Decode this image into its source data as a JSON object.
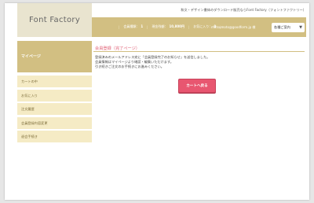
{
  "brand": {
    "logo": "Font Factory"
  },
  "header": {
    "tagline": "和文・デザイン書体のダウンロード販売ならFont Factory（フォントファクトリー）",
    "stats": [
      {
        "label": "会員種類：",
        "value": "1"
      },
      {
        "label": "現金残額：",
        "value": "10,800円"
      },
      {
        "label": "お気に入り：",
        "value": "0"
      }
    ],
    "email": "matsumoto@goodform.jp 様",
    "menu_button": "各種ご案内"
  },
  "sidebar": {
    "heading": "マイページ",
    "items": [
      {
        "label": "カートの中"
      },
      {
        "label": "お気に入り"
      },
      {
        "label": "注文履歴"
      },
      {
        "label": "会員登録内容変更"
      },
      {
        "label": "退会手続き"
      }
    ]
  },
  "main": {
    "title": "会員登録（完了ページ）",
    "lines": [
      "登録済みのメールアドレス宛に「会員登録完了のお知らせ」を送信しました。",
      "会員情報はマイページより確認・編集いただけます。",
      "引き続きご注文のお手続きにお進みください。"
    ],
    "cart_button": "カートへ戻る"
  },
  "colors": {
    "accent_gold": "#d2bf82",
    "sidebar_item_bg": "#f5ebc5",
    "title_pink": "#e06377",
    "button_pink": "#e85670"
  }
}
